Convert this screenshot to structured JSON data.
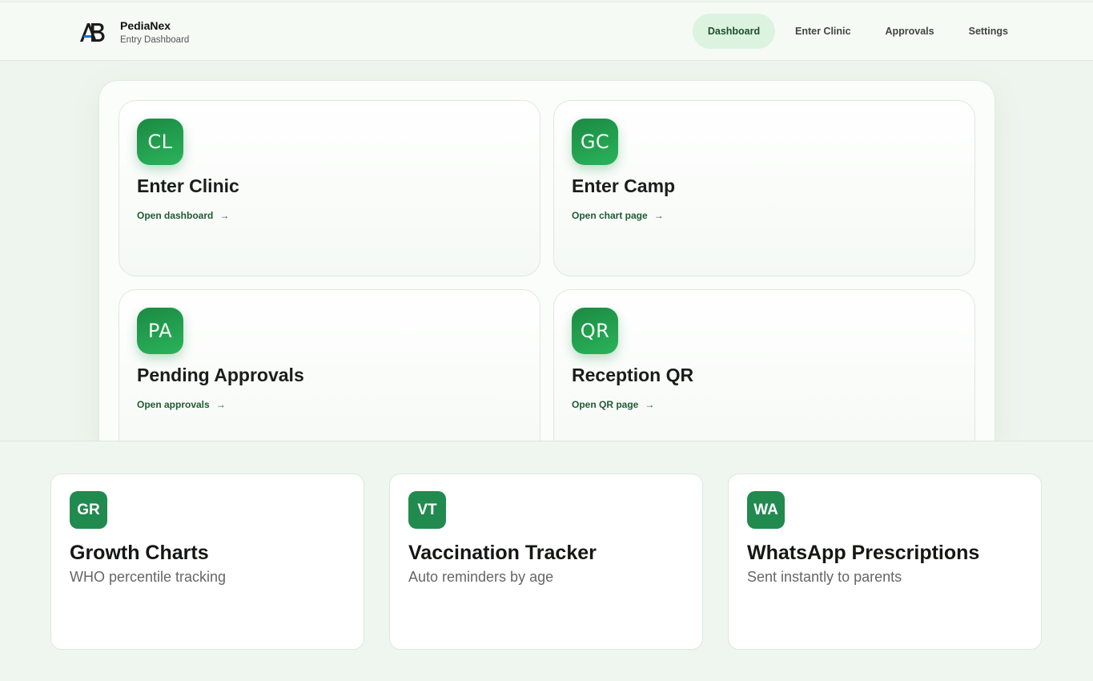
{
  "brand": {
    "name": "PediaNex",
    "subtitle": "Entry Dashboard",
    "logo_text": "AB"
  },
  "nav": {
    "items": [
      {
        "label": "Dashboard",
        "active": true
      },
      {
        "label": "Enter Clinic",
        "active": false
      },
      {
        "label": "Approvals",
        "active": false
      },
      {
        "label": "Settings",
        "active": false
      }
    ]
  },
  "tiles": [
    {
      "badge": "CL",
      "title": "Enter Clinic",
      "link": "Open dashboard",
      "arrow": "→"
    },
    {
      "badge": "GC",
      "title": "Enter Camp",
      "link": "Open chart page",
      "arrow": "→"
    },
    {
      "badge": "PA",
      "title": "Pending Approvals",
      "link": "Open approvals",
      "arrow": "→"
    },
    {
      "badge": "QR",
      "title": "Reception QR",
      "link": "Open QR page",
      "arrow": "→"
    }
  ],
  "features": [
    {
      "badge": "GR",
      "title": "Growth Charts",
      "subtitle": "WHO percentile tracking"
    },
    {
      "badge": "VT",
      "title": "Vaccination Tracker",
      "subtitle": "Auto reminders by age"
    },
    {
      "badge": "WA",
      "title": "WhatsApp Prescriptions",
      "subtitle": "Sent instantly to parents"
    }
  ],
  "colors": {
    "accent": "#1b8a43",
    "accent_light": "#dcf3e0",
    "feature_badge": "#218a4f",
    "background": "#eef5ee"
  }
}
